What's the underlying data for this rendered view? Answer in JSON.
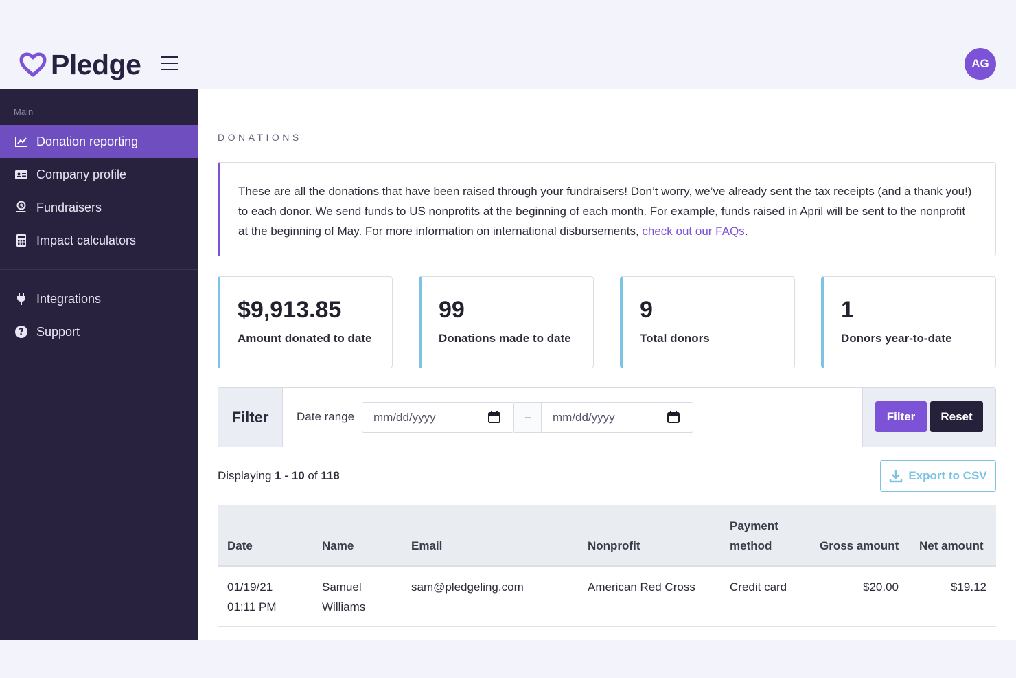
{
  "header": {
    "logo_text": "Pledge",
    "avatar_initials": "AG",
    "brand_color": "#7c52d6"
  },
  "sidebar": {
    "section_label": "Main",
    "items": [
      {
        "label": "Donation reporting",
        "icon": "chart-line-icon",
        "active": true
      },
      {
        "label": "Company profile",
        "icon": "id-card-icon"
      },
      {
        "label": "Fundraisers",
        "icon": "hand-coin-icon"
      },
      {
        "label": "Impact calculators",
        "icon": "calculator-icon"
      }
    ],
    "secondary_items": [
      {
        "label": "Integrations",
        "icon": "plug-icon"
      },
      {
        "label": "Support",
        "icon": "question-circle-icon"
      }
    ]
  },
  "main": {
    "section_title": "DONATIONS",
    "notice": {
      "text": "These are all the donations that have been raised through your fundraisers! Don’t worry, we’ve already sent the tax receipts (and a thank you!) to each donor. We send funds to US nonprofits at the beginning of each month. For example, funds raised in April will be sent to the nonprofit at the beginning of May. For more information on international disbursements, ",
      "link_text": "check out our FAQs",
      "suffix": "."
    },
    "stats": [
      {
        "value": "$9,913.85",
        "label": "Amount donated to date"
      },
      {
        "value": "99",
        "label": "Donations made to date"
      },
      {
        "value": "9",
        "label": "Total donors"
      },
      {
        "value": "1",
        "label": "Donors year-to-date"
      }
    ],
    "filter": {
      "title": "Filter",
      "date_range_label": "Date range",
      "start_placeholder": "mm/dd/yyyy",
      "separator": "–",
      "end_placeholder": "mm/dd/yyyy",
      "filter_button": "Filter",
      "reset_button": "Reset"
    },
    "display": {
      "prefix": "Displaying",
      "range": "1 - 10",
      "of": "of",
      "total": "118"
    },
    "export_label": "Export to CSV",
    "table": {
      "headers": {
        "date": "Date",
        "name": "Name",
        "email": "Email",
        "nonprofit": "Nonprofit",
        "payment_line1": "Payment",
        "payment_line2": "method",
        "gross": "Gross amount",
        "net": "Net amount"
      },
      "rows": [
        {
          "date": "01/19/21",
          "time": "01:11 PM",
          "first_name": "Samuel",
          "last_name": "Williams",
          "email": "sam@pledgeling.com",
          "nonprofit": "American Red Cross",
          "payment_method": "Credit card",
          "gross": "$20.00",
          "net": "$19.12"
        }
      ]
    }
  }
}
